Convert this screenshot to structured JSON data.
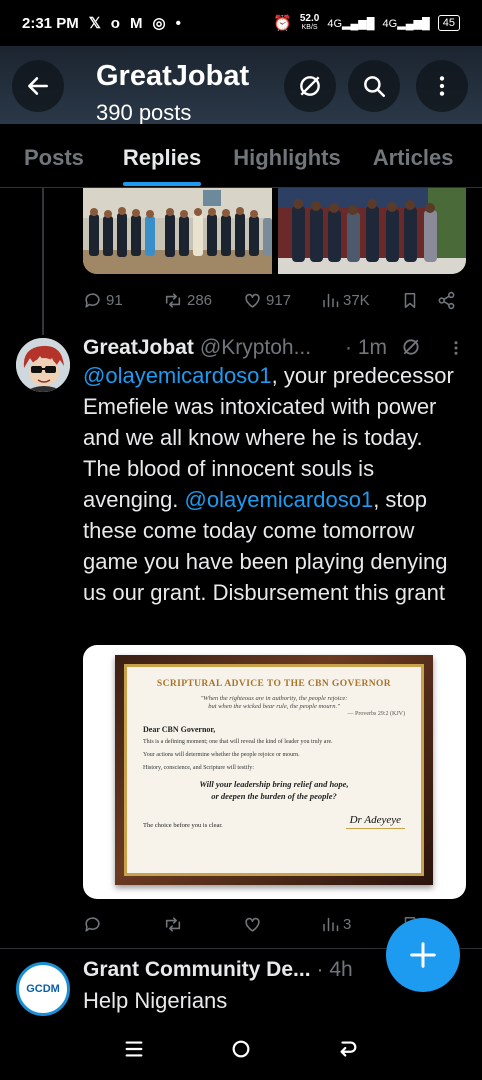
{
  "status_bar": {
    "time": "2:31 PM",
    "speed": "52.0",
    "speed_unit": "KB/S",
    "network_1": "4G",
    "network_2": "4G",
    "battery": "45"
  },
  "header": {
    "title": "GreatJobat",
    "posts_count": "390 posts"
  },
  "tabs": [
    {
      "label": "Posts",
      "active": false
    },
    {
      "label": "Replies",
      "active": true
    },
    {
      "label": "Highlights",
      "active": false
    },
    {
      "label": "Articles",
      "active": false
    }
  ],
  "first_tweet_actions": {
    "replies": "91",
    "reposts": "286",
    "likes": "917",
    "views": "37K"
  },
  "reply_tweet": {
    "name": "GreatJobat",
    "handle": "@Kryptoh...",
    "time": "· 1m",
    "mention": "@olayemicardoso1",
    "text_1": ", your predecessor Emefiele was intoxicated with power and we all know where he is today. The blood of innocent souls is avenging. ",
    "text_2": ", stop these come today come tomorrow game you have been playing denying us our grant. Disbursement this grant",
    "image": {
      "title": "SCRIPTURAL ADVICE TO THE CBN GOVERNOR",
      "quote_line_1": "\"When the righteous are in authority, the people rejoice:",
      "quote_line_2": "but when the wicked bear rule, the people mourn.\"",
      "quote_ref": "— Proverbs 29:2 (KJV)",
      "salutation": "Dear CBN Governor,",
      "para_1": "This is a defining moment; one that will reveal the kind of leader you truly are.",
      "para_2": "Your actions will determine whether the people rejoice or mourn.",
      "para_3": "History, conscience, and Scripture will testify:",
      "question_1": "Will your leadership bring relief and hope,",
      "question_2": "or deepen the burden of the people?",
      "closing": "The choice before you is clear.",
      "signature": "Dr Adeyeye"
    },
    "actions": {
      "views": "3"
    }
  },
  "next_tweet": {
    "avatar_text": "GCDM",
    "name": "Grant Community De...",
    "time": "· 4h",
    "text": "Help Nigerians"
  },
  "colors": {
    "accent": "#1d9bf0",
    "muted": "#71767b",
    "background": "#000000"
  }
}
